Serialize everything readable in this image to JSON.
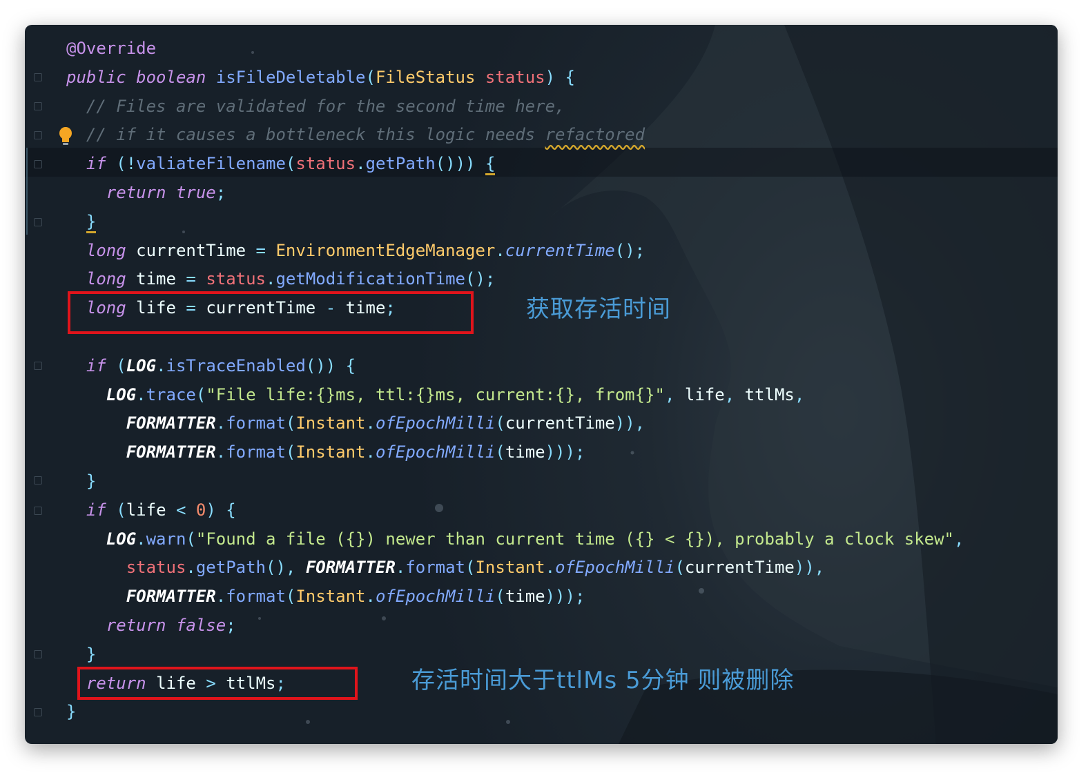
{
  "code_lines": [
    [
      [
        "anno",
        "@Override"
      ]
    ],
    [
      [
        "kw",
        "public "
      ],
      [
        "kw",
        "boolean "
      ],
      [
        "fn",
        "isFileDeletable"
      ],
      [
        "op",
        "("
      ],
      [
        "cls",
        "FileStatus "
      ],
      [
        "param",
        "status"
      ],
      [
        "op",
        ") {"
      ]
    ],
    [
      [
        "plain",
        "  "
      ],
      [
        "cm",
        "// Files are validated for the second time here,"
      ]
    ],
    [
      [
        "plain",
        "  "
      ],
      [
        "cm",
        "// if it causes a bottleneck this logic needs "
      ],
      [
        "cmw",
        "refactored"
      ]
    ],
    [
      [
        "plain",
        "  "
      ],
      [
        "kw",
        "if "
      ],
      [
        "op",
        "(!"
      ],
      [
        "fn",
        "valiateFilename"
      ],
      [
        "op",
        "("
      ],
      [
        "param",
        "status"
      ],
      [
        "op",
        "."
      ],
      [
        "fn",
        "getPath"
      ],
      [
        "op",
        "())) "
      ],
      [
        "brace",
        "{"
      ]
    ],
    [
      [
        "plain",
        "    "
      ],
      [
        "kw",
        "return "
      ],
      [
        "kw",
        "true"
      ],
      [
        "op",
        ";"
      ]
    ],
    [
      [
        "plain",
        "  "
      ],
      [
        "brace",
        "}"
      ]
    ],
    [
      [
        "plain",
        "  "
      ],
      [
        "kw",
        "long "
      ],
      [
        "plain",
        "currentTime "
      ],
      [
        "op",
        "= "
      ],
      [
        "cls",
        "EnvironmentEdgeManager"
      ],
      [
        "op",
        "."
      ],
      [
        "fni",
        "currentTime"
      ],
      [
        "op",
        "();"
      ]
    ],
    [
      [
        "plain",
        "  "
      ],
      [
        "kw",
        "long "
      ],
      [
        "plain",
        "time "
      ],
      [
        "op",
        "= "
      ],
      [
        "param",
        "status"
      ],
      [
        "op",
        "."
      ],
      [
        "fn",
        "getModificationTime"
      ],
      [
        "op",
        "();"
      ]
    ],
    [
      [
        "plain",
        "  "
      ],
      [
        "kw",
        "long "
      ],
      [
        "plain",
        "life "
      ],
      [
        "op",
        "= "
      ],
      [
        "plain",
        "currentTime "
      ],
      [
        "op",
        "- "
      ],
      [
        "plain",
        "time"
      ],
      [
        "op",
        ";"
      ]
    ],
    [
      [
        "plain",
        ""
      ]
    ],
    [
      [
        "plain",
        "  "
      ],
      [
        "kw",
        "if "
      ],
      [
        "op",
        "("
      ],
      [
        "const",
        "LOG"
      ],
      [
        "op",
        "."
      ],
      [
        "fn",
        "isTraceEnabled"
      ],
      [
        "op",
        "()) {"
      ]
    ],
    [
      [
        "plain",
        "    "
      ],
      [
        "const",
        "LOG"
      ],
      [
        "op",
        "."
      ],
      [
        "fn",
        "trace"
      ],
      [
        "op",
        "("
      ],
      [
        "str",
        "\"File life:{}ms, ttl:{}ms, current:{}, from{}\""
      ],
      [
        "op",
        ", "
      ],
      [
        "plain",
        "life"
      ],
      [
        "op",
        ", "
      ],
      [
        "plain",
        "ttlMs"
      ],
      [
        "op",
        ","
      ]
    ],
    [
      [
        "plain",
        "      "
      ],
      [
        "const",
        "FORMATTER"
      ],
      [
        "op",
        "."
      ],
      [
        "fn",
        "format"
      ],
      [
        "op",
        "("
      ],
      [
        "cls",
        "Instant"
      ],
      [
        "op",
        "."
      ],
      [
        "fni",
        "ofEpochMilli"
      ],
      [
        "op",
        "("
      ],
      [
        "plain",
        "currentTime"
      ],
      [
        "op",
        ")),"
      ]
    ],
    [
      [
        "plain",
        "      "
      ],
      [
        "const",
        "FORMATTER"
      ],
      [
        "op",
        "."
      ],
      [
        "fn",
        "format"
      ],
      [
        "op",
        "("
      ],
      [
        "cls",
        "Instant"
      ],
      [
        "op",
        "."
      ],
      [
        "fni",
        "ofEpochMilli"
      ],
      [
        "op",
        "("
      ],
      [
        "plain",
        "time"
      ],
      [
        "op",
        ")));"
      ]
    ],
    [
      [
        "plain",
        "  "
      ],
      [
        "op",
        "}"
      ]
    ],
    [
      [
        "plain",
        "  "
      ],
      [
        "kw",
        "if "
      ],
      [
        "op",
        "("
      ],
      [
        "plain",
        "life "
      ],
      [
        "op",
        "< "
      ],
      [
        "num",
        "0"
      ],
      [
        "op",
        ") {"
      ]
    ],
    [
      [
        "plain",
        "    "
      ],
      [
        "const",
        "LOG"
      ],
      [
        "op",
        "."
      ],
      [
        "fn",
        "warn"
      ],
      [
        "op",
        "("
      ],
      [
        "str",
        "\"Found a file ({}) newer than current time ({} < {}), probably a clock skew\""
      ],
      [
        "op",
        ","
      ]
    ],
    [
      [
        "plain",
        "      "
      ],
      [
        "param",
        "status"
      ],
      [
        "op",
        "."
      ],
      [
        "fn",
        "getPath"
      ],
      [
        "op",
        "(), "
      ],
      [
        "const",
        "FORMATTER"
      ],
      [
        "op",
        "."
      ],
      [
        "fn",
        "format"
      ],
      [
        "op",
        "("
      ],
      [
        "cls",
        "Instant"
      ],
      [
        "op",
        "."
      ],
      [
        "fni",
        "ofEpochMilli"
      ],
      [
        "op",
        "("
      ],
      [
        "plain",
        "currentTime"
      ],
      [
        "op",
        ")),"
      ]
    ],
    [
      [
        "plain",
        "      "
      ],
      [
        "const",
        "FORMATTER"
      ],
      [
        "op",
        "."
      ],
      [
        "fn",
        "format"
      ],
      [
        "op",
        "("
      ],
      [
        "cls",
        "Instant"
      ],
      [
        "op",
        "."
      ],
      [
        "fni",
        "ofEpochMilli"
      ],
      [
        "op",
        "("
      ],
      [
        "plain",
        "time"
      ],
      [
        "op",
        ")));"
      ]
    ],
    [
      [
        "plain",
        "    "
      ],
      [
        "kw",
        "return "
      ],
      [
        "kw",
        "false"
      ],
      [
        "op",
        ";"
      ]
    ],
    [
      [
        "plain",
        "  "
      ],
      [
        "op",
        "}"
      ]
    ],
    [
      [
        "plain",
        "  "
      ],
      [
        "kw",
        "return "
      ],
      [
        "plain",
        "life "
      ],
      [
        "op",
        "> "
      ],
      [
        "plain",
        "ttlMs"
      ],
      [
        "op",
        ";"
      ]
    ],
    [
      [
        "op",
        "}"
      ]
    ]
  ],
  "annotations": {
    "note1": "获取存活时间",
    "note2": "存活时间大于ttlMs 5分钟  则被删除"
  },
  "colors": {
    "highlight_box": "#e0141b",
    "note_text": "#4a9bd6"
  },
  "icons": {
    "intention_bulb": "lightbulb-icon"
  }
}
